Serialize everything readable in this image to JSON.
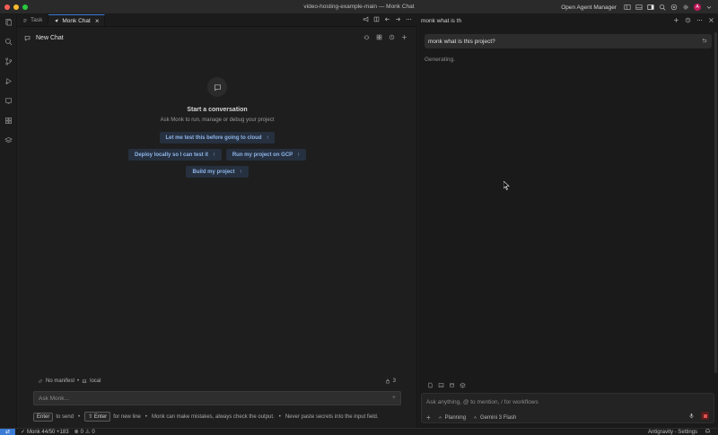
{
  "window": {
    "title": "video-hosting-example-main — Monk Chat",
    "agent_manager": "Open Agent Manager",
    "avatar_initial": "A"
  },
  "tabs": [
    {
      "label": "Task",
      "icon": "list-icon"
    },
    {
      "label": "Monk Chat",
      "icon": "monk-icon",
      "close": "×"
    }
  ],
  "chat": {
    "title": "New Chat",
    "empty_title": "Start a conversation",
    "empty_subtitle": "Ask Monk to run, manage or debug your project",
    "suggestions": [
      {
        "label": "Let me test this before going to cloud",
        "arrow": "↑"
      },
      {
        "label": "Deploy locally so I can test it",
        "arrow": "↑"
      },
      {
        "label": "Run my project on GCP",
        "arrow": "↑"
      },
      {
        "label": "Build my project",
        "arrow": "↑"
      }
    ],
    "manifest": "No manifest",
    "sep": "•",
    "env": "local",
    "lock_count": "3",
    "input_placeholder": "Ask Monk...",
    "plus": "+",
    "hint": {
      "enter_key": "Enter",
      "to_send": "to send",
      "shift_enter_key": "⇧ Enter",
      "new_line": "for new line",
      "disclaimer": "Monk can make mistakes, always check the output.",
      "dot": "•",
      "warning": "Never paste secrets into the input field."
    }
  },
  "agent": {
    "header": "monk what is th",
    "user_message": "monk what is this project?",
    "status": "Generating.",
    "input_placeholder": "Ask anything, @ to mention, / for workflows",
    "plus": "+",
    "mode": "Planning",
    "model": "Gemini 3 Flash"
  },
  "status_bar": {
    "remote_icon": "remote-icon",
    "monk": "Monk 44/50 +183",
    "errors": "0",
    "warnings": "0",
    "settings": "Antigravity - Settings"
  },
  "colors": {
    "accent": "#3a7bd5",
    "suggestion_bg": "#26303f",
    "suggestion_text": "#8fb6ea",
    "stop": "#e05252"
  }
}
